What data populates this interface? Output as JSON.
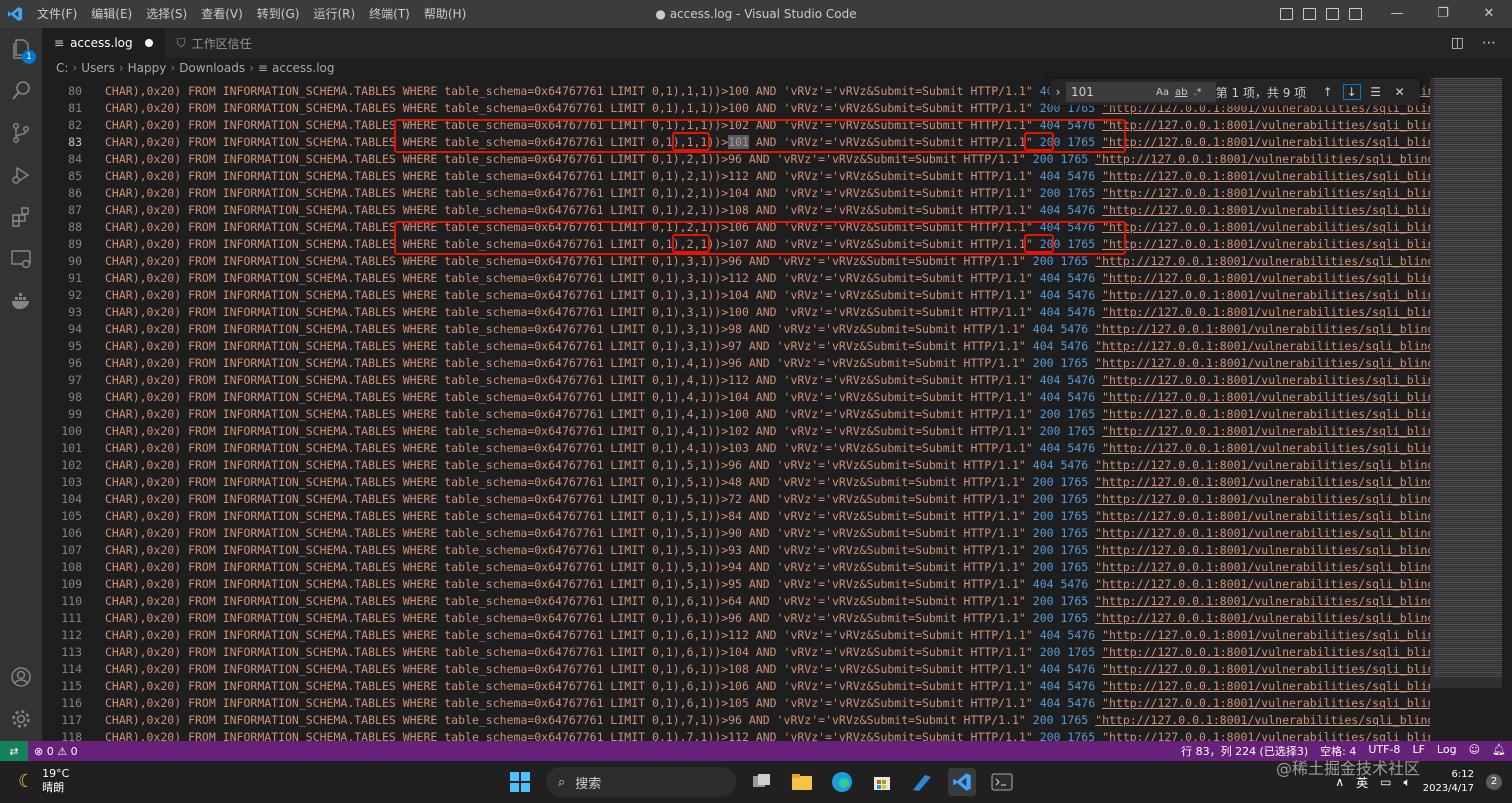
{
  "titlebar": {
    "menu": [
      "文件(F)",
      "编辑(E)",
      "选择(S)",
      "查看(V)",
      "转到(G)",
      "运行(R)",
      "终端(T)",
      "帮助(H)"
    ],
    "title": "● access.log - Visual Studio Code"
  },
  "tabs": [
    {
      "label": "access.log",
      "active": true,
      "dirty": true
    },
    {
      "label": "工作区信任",
      "active": false
    }
  ],
  "breadcrumb": [
    "C:",
    "Users",
    "Happy",
    "Downloads",
    "access.log"
  ],
  "find": {
    "query": "101",
    "opt_case": "Aa",
    "opt_word": "ab",
    "opt_regex": ".*",
    "count": "第 1 项，共 9 项"
  },
  "editor": {
    "current_line": 83,
    "prefix": "CHAR),0x20) FROM INFORMATION_SCHEMA.TABLES WHERE table_schema=0x64767761 LIMIT 0,1),",
    "mid": " AND 'vRVz'='vRVz&Submit=Submit HTTP/1.1\" ",
    "url": "\"http://127.0.0.1:8001/vulnerabilities/sqli_blind/",
    "lines": [
      {
        "n": 80,
        "pos": "1,1",
        "val": "100",
        "status": "404",
        "size": "5476"
      },
      {
        "n": 81,
        "pos": "1,1",
        "val": "100",
        "status": "200",
        "size": "1765"
      },
      {
        "n": 82,
        "pos": "1,1",
        "val": "102",
        "status": "404",
        "size": "5476"
      },
      {
        "n": 83,
        "pos": "1,1",
        "val": "101",
        "status": "200",
        "size": "1765"
      },
      {
        "n": 84,
        "pos": "2,1",
        "val": "96",
        "status": "200",
        "size": "1765"
      },
      {
        "n": 85,
        "pos": "2,1",
        "val": "112",
        "status": "404",
        "size": "5476"
      },
      {
        "n": 86,
        "pos": "2,1",
        "val": "104",
        "status": "200",
        "size": "1765"
      },
      {
        "n": 87,
        "pos": "2,1",
        "val": "108",
        "status": "404",
        "size": "5476"
      },
      {
        "n": 88,
        "pos": "2,1",
        "val": "106",
        "status": "404",
        "size": "5476"
      },
      {
        "n": 89,
        "pos": "2,1",
        "val": "107",
        "status": "200",
        "size": "1765"
      },
      {
        "n": 90,
        "pos": "3,1",
        "val": "96",
        "status": "200",
        "size": "1765"
      },
      {
        "n": 91,
        "pos": "3,1",
        "val": "112",
        "status": "404",
        "size": "5476"
      },
      {
        "n": 92,
        "pos": "3,1",
        "val": "104",
        "status": "404",
        "size": "5476"
      },
      {
        "n": 93,
        "pos": "3,1",
        "val": "100",
        "status": "404",
        "size": "5476"
      },
      {
        "n": 94,
        "pos": "3,1",
        "val": "98",
        "status": "404",
        "size": "5476"
      },
      {
        "n": 95,
        "pos": "3,1",
        "val": "97",
        "status": "404",
        "size": "5476"
      },
      {
        "n": 96,
        "pos": "4,1",
        "val": "96",
        "status": "200",
        "size": "1765"
      },
      {
        "n": 97,
        "pos": "4,1",
        "val": "112",
        "status": "404",
        "size": "5476"
      },
      {
        "n": 98,
        "pos": "4,1",
        "val": "104",
        "status": "404",
        "size": "5476"
      },
      {
        "n": 99,
        "pos": "4,1",
        "val": "100",
        "status": "200",
        "size": "1765"
      },
      {
        "n": 100,
        "pos": "4,1",
        "val": "102",
        "status": "200",
        "size": "1765"
      },
      {
        "n": 101,
        "pos": "4,1",
        "val": "103",
        "status": "404",
        "size": "5476"
      },
      {
        "n": 102,
        "pos": "5,1",
        "val": "96",
        "status": "404",
        "size": "5476"
      },
      {
        "n": 103,
        "pos": "5,1",
        "val": "48",
        "status": "200",
        "size": "1765"
      },
      {
        "n": 104,
        "pos": "5,1",
        "val": "72",
        "status": "200",
        "size": "1765"
      },
      {
        "n": 105,
        "pos": "5,1",
        "val": "84",
        "status": "200",
        "size": "1765"
      },
      {
        "n": 106,
        "pos": "5,1",
        "val": "90",
        "status": "200",
        "size": "1765"
      },
      {
        "n": 107,
        "pos": "5,1",
        "val": "93",
        "status": "200",
        "size": "1765"
      },
      {
        "n": 108,
        "pos": "5,1",
        "val": "94",
        "status": "200",
        "size": "1765"
      },
      {
        "n": 109,
        "pos": "5,1",
        "val": "95",
        "status": "404",
        "size": "5476"
      },
      {
        "n": 110,
        "pos": "6,1",
        "val": "64",
        "status": "200",
        "size": "1765"
      },
      {
        "n": 111,
        "pos": "6,1",
        "val": "96",
        "status": "200",
        "size": "1765"
      },
      {
        "n": 112,
        "pos": "6,1",
        "val": "112",
        "status": "404",
        "size": "5476"
      },
      {
        "n": 113,
        "pos": "6,1",
        "val": "104",
        "status": "200",
        "size": "1765"
      },
      {
        "n": 114,
        "pos": "6,1",
        "val": "108",
        "status": "404",
        "size": "5476"
      },
      {
        "n": 115,
        "pos": "6,1",
        "val": "106",
        "status": "404",
        "size": "5476"
      },
      {
        "n": 116,
        "pos": "6,1",
        "val": "105",
        "status": "404",
        "size": "5476"
      },
      {
        "n": 117,
        "pos": "7,1",
        "val": "96",
        "status": "200",
        "size": "1765"
      },
      {
        "n": 118,
        "pos": "7,1",
        "val": "112",
        "status": "200",
        "size": "1765"
      }
    ]
  },
  "statusbar": {
    "problems": "⊗ 0 ⚠ 0",
    "position": "行 83，列 224 (已选择3)",
    "spaces": "空格: 4",
    "encoding": "UTF-8",
    "eol": "LF",
    "language": "Log"
  },
  "taskbar": {
    "temperature": "19°C",
    "weather": "晴朗",
    "search_placeholder": "搜索",
    "ime": "英",
    "time": "6:12",
    "date": "2023/4/17",
    "notification_count": "2",
    "watermark": "@稀土掘金技术社区"
  },
  "colors": {
    "accent": "#007acc",
    "statusbar": "#68217a",
    "highlight_box": "#e51400",
    "string": "#ce9178",
    "number": "#569cd6"
  }
}
